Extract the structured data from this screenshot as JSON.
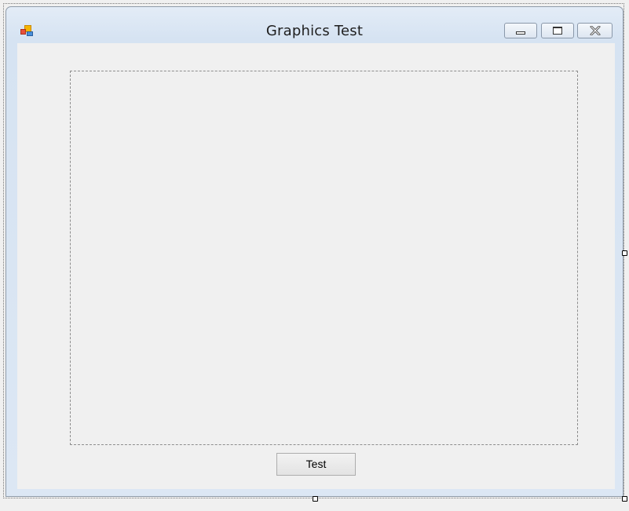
{
  "window": {
    "title": "Graphics Test",
    "icon": "form-icon"
  },
  "caption_buttons": {
    "minimize": "minimize-icon",
    "maximize": "maximize-icon",
    "close": "close-icon"
  },
  "form": {
    "button_label": "Test"
  }
}
